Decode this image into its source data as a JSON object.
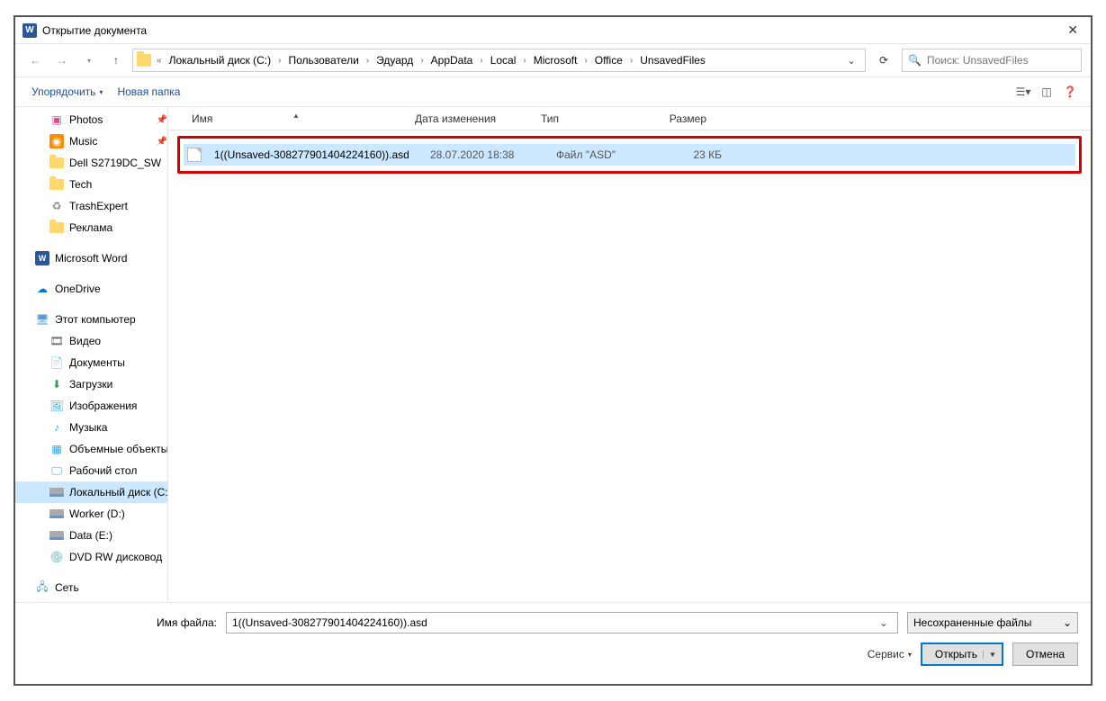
{
  "window": {
    "title": "Открытие документа"
  },
  "breadcrumb": {
    "items": [
      "Локальный диск (C:)",
      "Пользователи",
      "Эдуард",
      "AppData",
      "Local",
      "Microsoft",
      "Office",
      "UnsavedFiles"
    ]
  },
  "search": {
    "placeholder": "Поиск: UnsavedFiles"
  },
  "toolbar": {
    "organize": "Упорядочить",
    "newfolder": "Новая папка"
  },
  "sidebar": {
    "items": [
      {
        "label": "Photos",
        "icon": "photos",
        "pin": true,
        "indent": true
      },
      {
        "label": "Music",
        "icon": "music",
        "pin": true,
        "indent": true
      },
      {
        "label": "Dell S2719DC_SW",
        "icon": "folder",
        "indent": true
      },
      {
        "label": "Tech",
        "icon": "folder",
        "indent": true
      },
      {
        "label": "TrashExpert",
        "icon": "trash",
        "indent": true
      },
      {
        "label": "Реклама",
        "icon": "folder",
        "indent": true
      },
      {
        "spacer": true
      },
      {
        "label": "Microsoft Word",
        "icon": "word"
      },
      {
        "spacer": true
      },
      {
        "label": "OneDrive",
        "icon": "cloud"
      },
      {
        "spacer": true
      },
      {
        "label": "Этот компьютер",
        "icon": "pc"
      },
      {
        "label": "Видео",
        "icon": "video",
        "indent": true
      },
      {
        "label": "Документы",
        "icon": "docs",
        "indent": true
      },
      {
        "label": "Загрузки",
        "icon": "down",
        "indent": true
      },
      {
        "label": "Изображения",
        "icon": "img",
        "indent": true
      },
      {
        "label": "Музыка",
        "icon": "music2",
        "indent": true
      },
      {
        "label": "Объемные объекты",
        "icon": "3d",
        "indent": true
      },
      {
        "label": "Рабочий стол",
        "icon": "desk",
        "indent": true
      },
      {
        "label": "Локальный диск (C:)",
        "icon": "drive",
        "indent": true,
        "selected": true
      },
      {
        "label": "Worker (D:)",
        "icon": "drive",
        "indent": true
      },
      {
        "label": "Data (E:)",
        "icon": "drive",
        "indent": true
      },
      {
        "label": "DVD RW дисковод",
        "icon": "dvd",
        "indent": true
      },
      {
        "spacer": true
      },
      {
        "label": "Сеть",
        "icon": "net"
      }
    ]
  },
  "columns": {
    "name": "Имя",
    "date": "Дата изменения",
    "type": "Тип",
    "size": "Размер"
  },
  "files": [
    {
      "name": "1((Unsaved-308277901404224160)).asd",
      "date": "28.07.2020 18:38",
      "type": "Файл \"ASD\"",
      "size": "23 КБ"
    }
  ],
  "footer": {
    "filename_label": "Имя файла:",
    "filename_value": "1((Unsaved-308277901404224160)).asd",
    "filetype": "Несохраненные файлы",
    "tools": "Сервис",
    "open": "Открыть",
    "cancel": "Отмена"
  }
}
